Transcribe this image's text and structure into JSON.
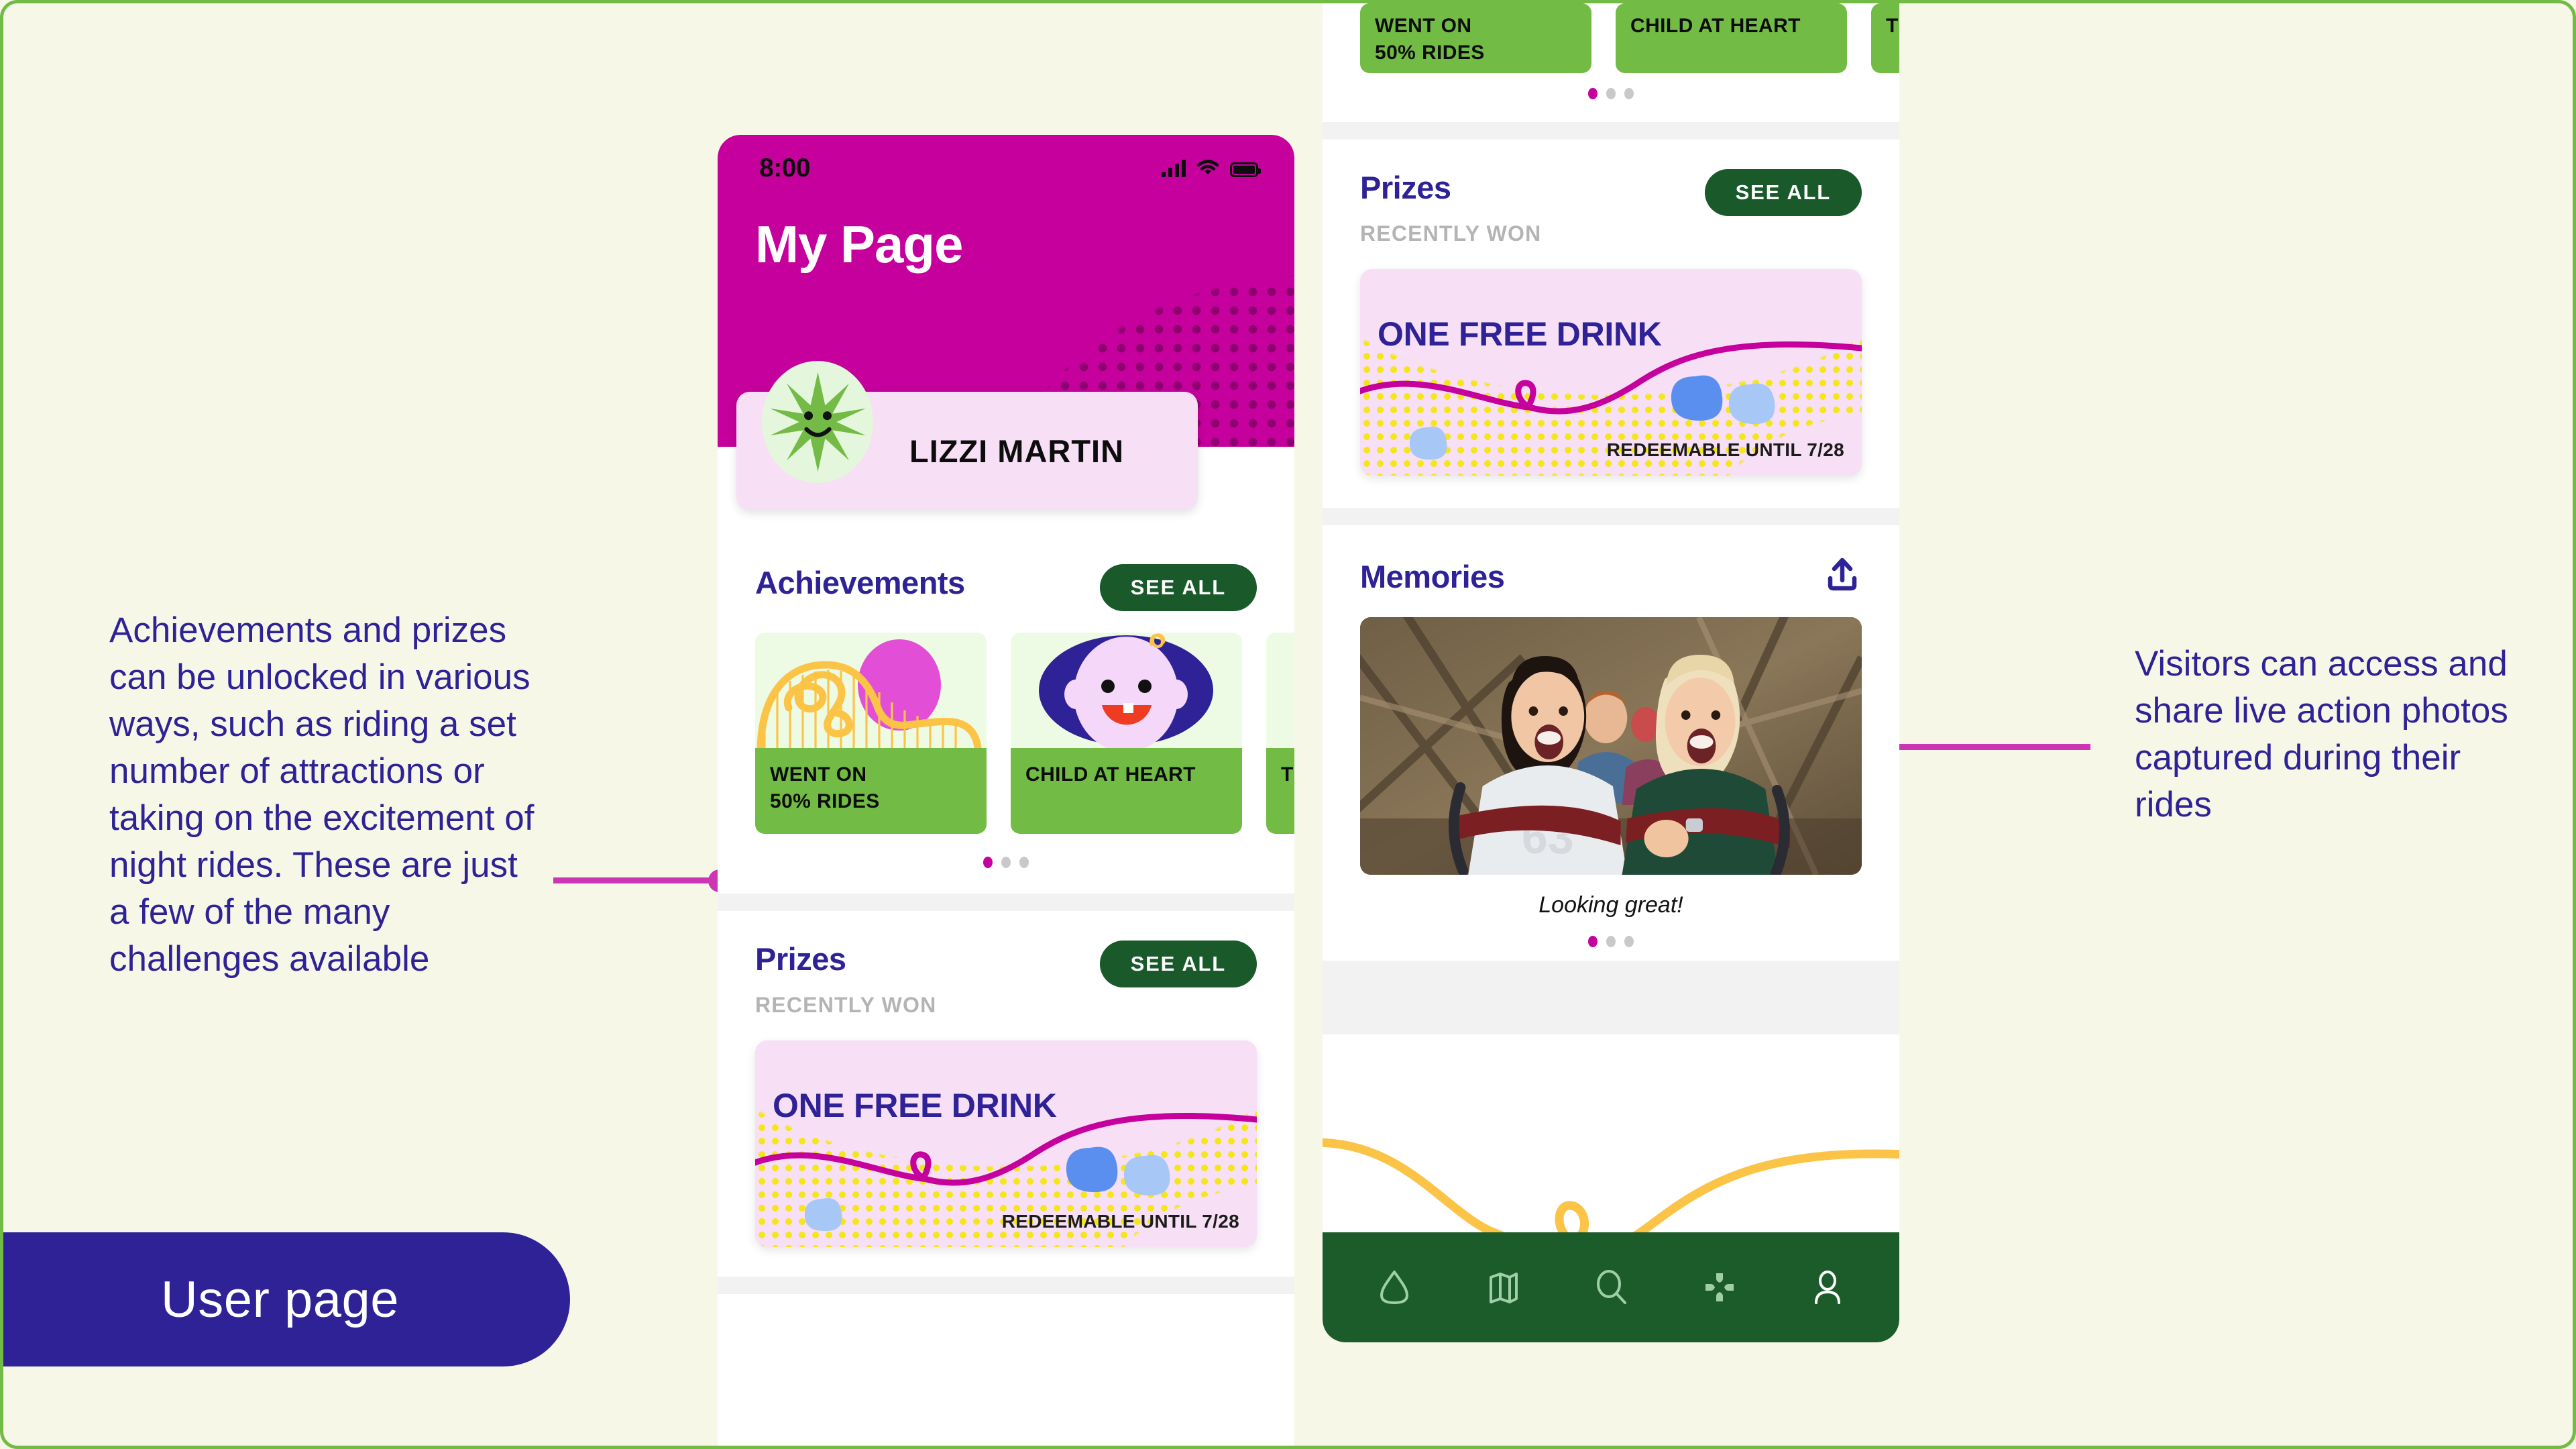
{
  "canvas": {
    "background_color": "#f7f7e8",
    "border_color": "#72bb44"
  },
  "label_pill": {
    "text": "User page",
    "background_color": "#2e2296",
    "text_color": "#ffffff"
  },
  "annotations": [
    {
      "id": "left",
      "text": "Achievements and prizes can be unlocked in various ways, such as riding a set number of attractions or taking on the excitement of night rides. These are just a few of the many challenges available",
      "color": "#2e2296",
      "connector_color": "#cc36b5"
    },
    {
      "id": "right",
      "text": "Visitors can access and share live action photos captured during their rides",
      "color": "#2e2296",
      "connector_color": "#cc36b5"
    }
  ],
  "phone_left": {
    "status_bar": {
      "time": "8:00",
      "icons": [
        "signal-icon",
        "wifi-icon",
        "battery-icon"
      ]
    },
    "header": {
      "title": "My Page",
      "background_color": "#c5009c"
    },
    "profile": {
      "name": "LIZZI MARTIN",
      "avatar_icon": "smiling-star-avatar",
      "card_color": "#f7dff6"
    },
    "achievements": {
      "title": "Achievements",
      "see_all_label": "SEE ALL",
      "cards": [
        {
          "label": "WENT ON\n50% RIDES",
          "art": "rollercoaster-art"
        },
        {
          "label": "CHILD AT HEART",
          "art": "baby-face-art"
        },
        {
          "label": "T",
          "art": "partial-art"
        }
      ],
      "pager": {
        "count": 3,
        "active": 0
      }
    },
    "prizes": {
      "title": "Prizes",
      "subtitle": "RECENTLY WON",
      "see_all_label": "SEE ALL",
      "card": {
        "title": "ONE FREE DRINK",
        "note": "REDEEMABLE UNTIL 7/28",
        "background_color": "#f7dff6",
        "dot_color": "#f5e61c",
        "squiggle_color": "#c5009c"
      }
    }
  },
  "phone_right": {
    "achievements_tail": {
      "cards": [
        {
          "label": "WENT ON\n50% RIDES"
        },
        {
          "label": "CHILD AT HEART"
        },
        {
          "label": "T"
        }
      ],
      "pager": {
        "count": 3,
        "active": 0
      }
    },
    "prizes": {
      "title": "Prizes",
      "subtitle": "RECENTLY WON",
      "see_all_label": "SEE ALL",
      "card": {
        "title": "ONE FREE DRINK",
        "note": "REDEEMABLE UNTIL 7/28"
      }
    },
    "memories": {
      "title": "Memories",
      "share_icon": "share-upload-icon",
      "photo_alt": "two-women-on-rollercoaster-photo",
      "caption": "Looking great!",
      "pager": {
        "count": 3,
        "active": 0
      }
    },
    "nav": {
      "background_color": "#1c5c2b",
      "items": [
        {
          "icon": "home-icon",
          "active": false
        },
        {
          "icon": "map-icon",
          "active": false
        },
        {
          "icon": "search-icon",
          "active": false
        },
        {
          "icon": "games-dpad-icon",
          "active": false
        },
        {
          "icon": "profile-person-icon",
          "active": true
        }
      ]
    }
  }
}
